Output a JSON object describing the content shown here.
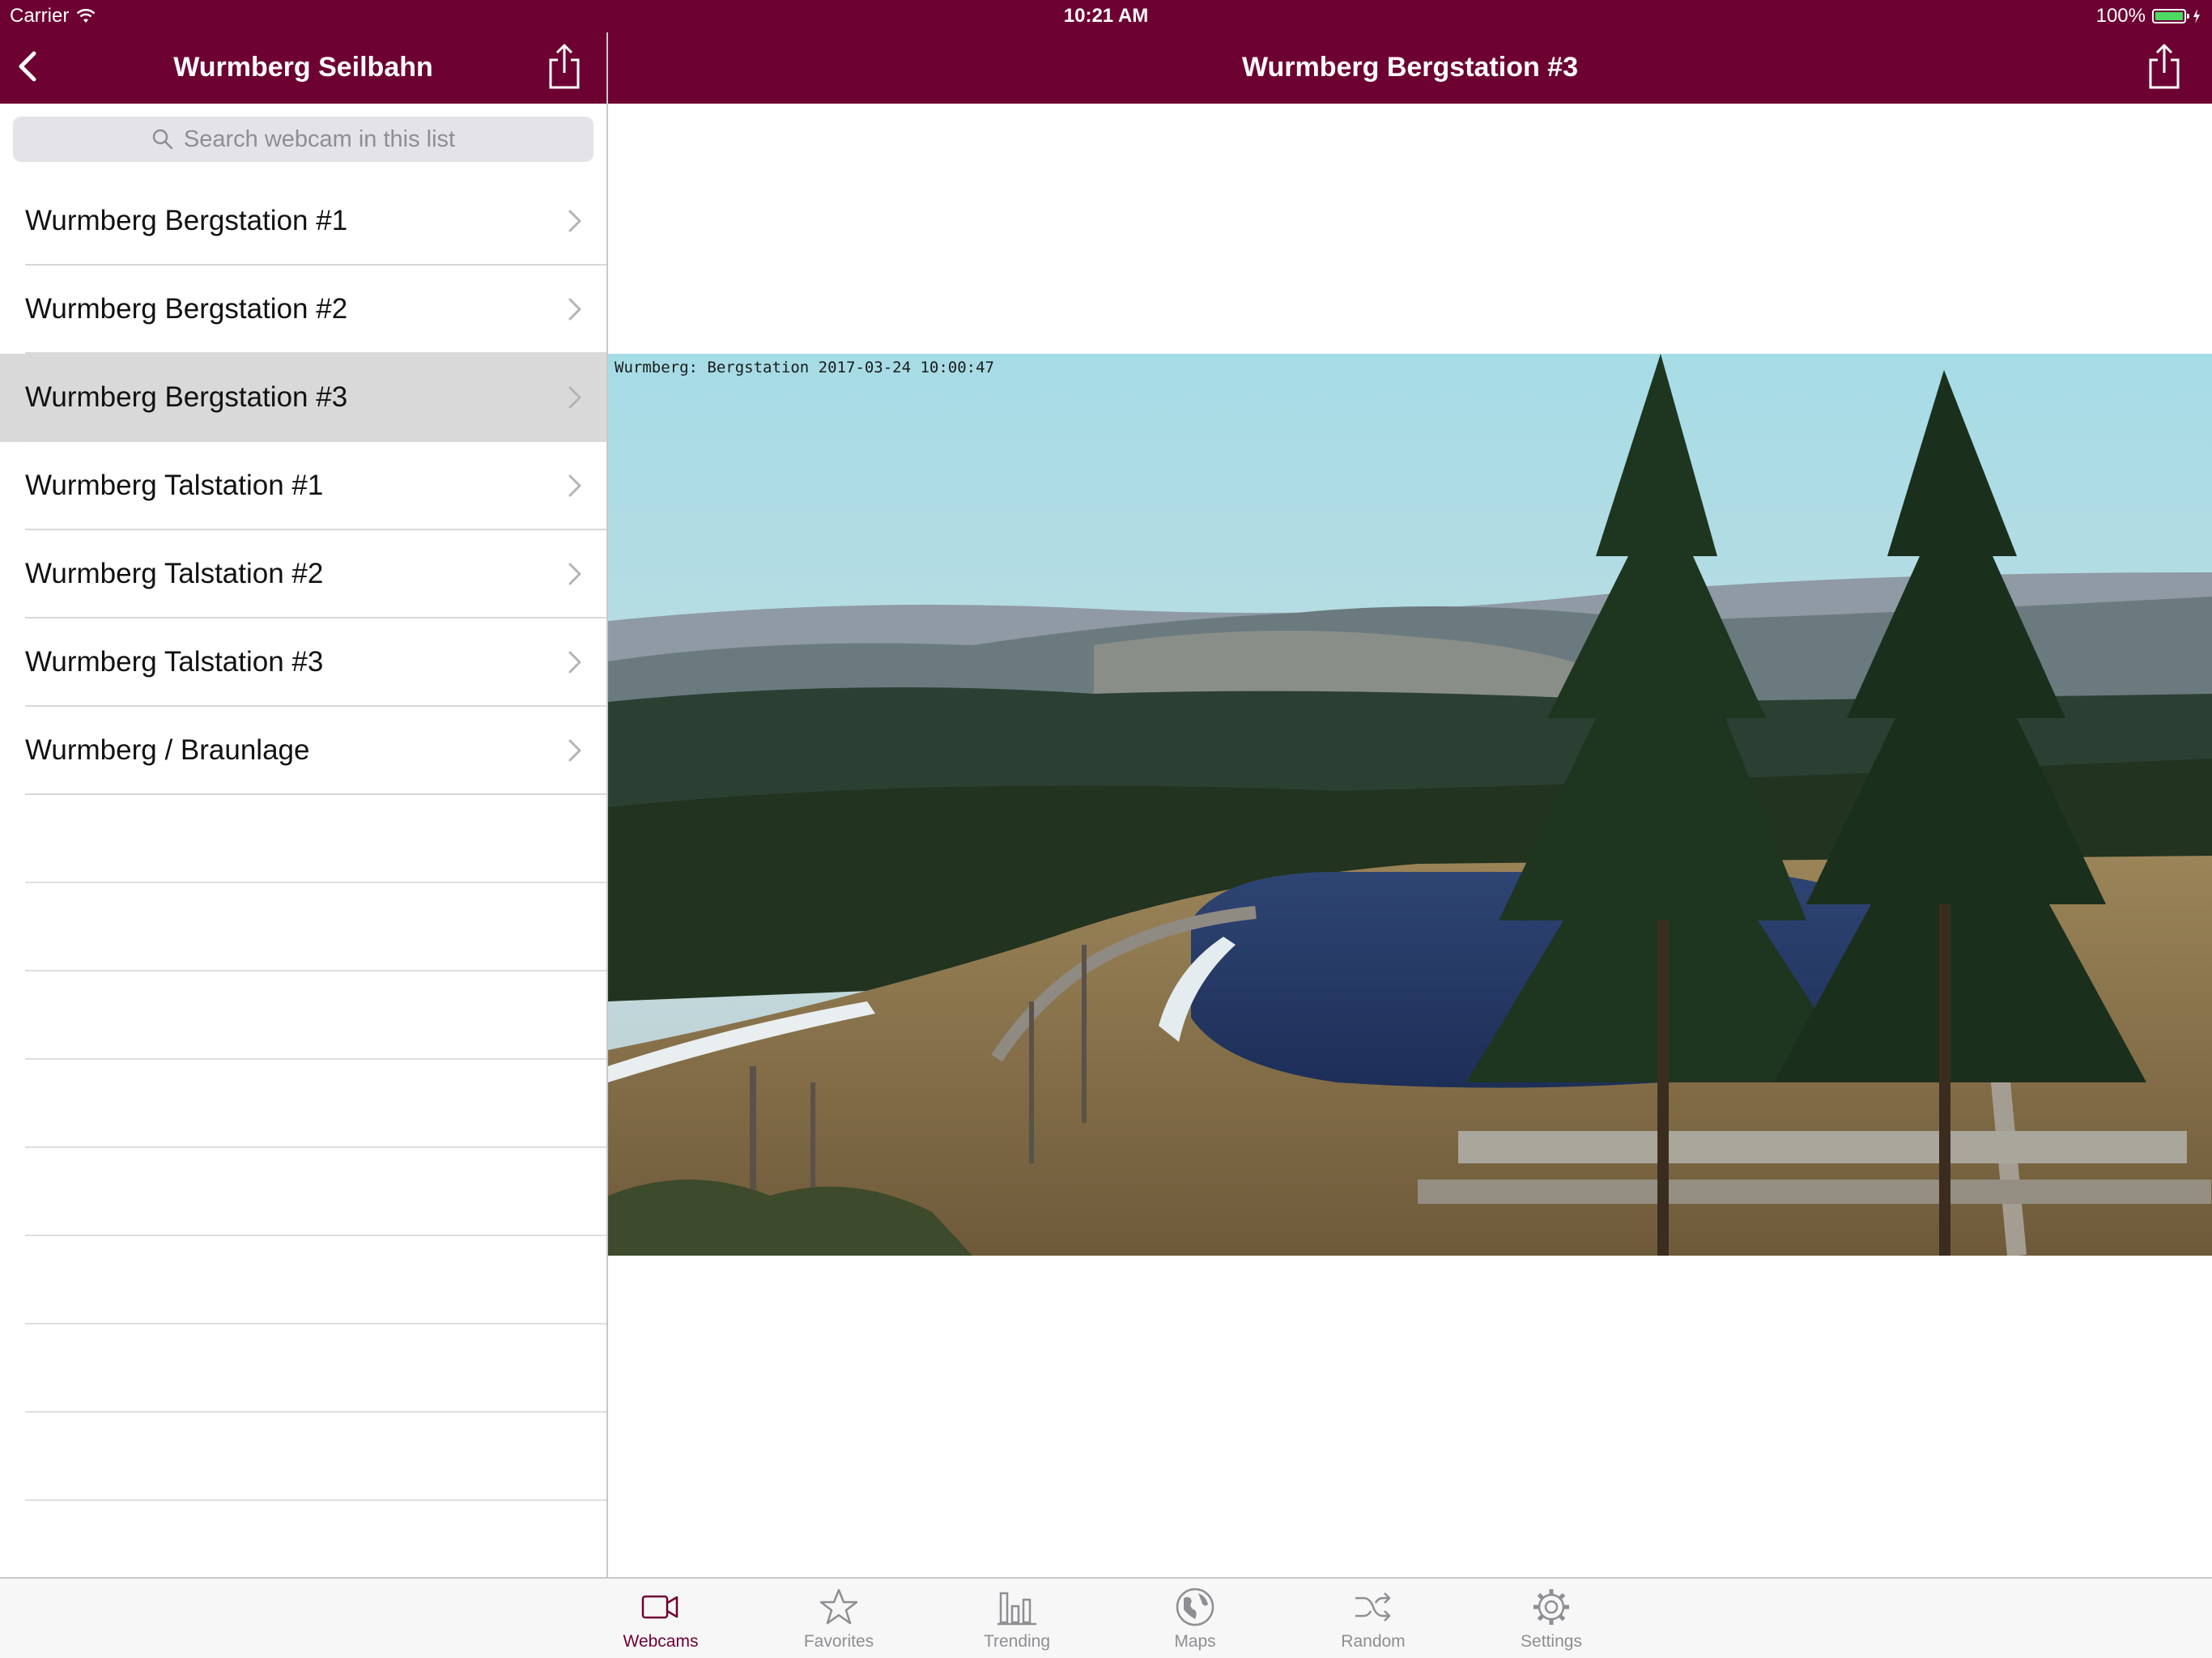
{
  "status_bar": {
    "carrier": "Carrier",
    "time": "10:21 AM",
    "battery": "100%",
    "battery_level": 1.0
  },
  "left_nav": {
    "title": "Wurmberg Seilbahn",
    "back_icon": "chevron-left-icon",
    "share_icon": "share-icon"
  },
  "right_nav": {
    "title": "Wurmberg Bergstation #3",
    "share_icon": "share-icon"
  },
  "search": {
    "placeholder": "Search webcam in this list",
    "icon": "search-icon"
  },
  "webcam_list": {
    "items": [
      {
        "label": "Wurmberg Bergstation #1",
        "selected": false
      },
      {
        "label": "Wurmberg Bergstation #2",
        "selected": false
      },
      {
        "label": "Wurmberg Bergstation #3",
        "selected": true
      },
      {
        "label": "Wurmberg Talstation #1",
        "selected": false
      },
      {
        "label": "Wurmberg Talstation #2",
        "selected": false
      },
      {
        "label": "Wurmberg Talstation #3",
        "selected": false
      },
      {
        "label": "Wurmberg / Braunlage",
        "selected": false
      }
    ]
  },
  "webcam_image": {
    "stamp": "Wurmberg: Bergstation 2017-03-24 10:00:47"
  },
  "tabs": [
    {
      "label": "Webcams",
      "icon": "video-camera-icon",
      "active": true
    },
    {
      "label": "Favorites",
      "icon": "star-icon",
      "active": false
    },
    {
      "label": "Trending",
      "icon": "bar-chart-icon",
      "active": false
    },
    {
      "label": "Maps",
      "icon": "globe-icon",
      "active": false
    },
    {
      "label": "Random",
      "icon": "shuffle-icon",
      "active": false
    },
    {
      "label": "Settings",
      "icon": "gear-icon",
      "active": false
    }
  ],
  "colors": {
    "brand": "#6d0132",
    "selected_row": "#d9d9d9",
    "tab_inactive": "#8e8e93"
  }
}
